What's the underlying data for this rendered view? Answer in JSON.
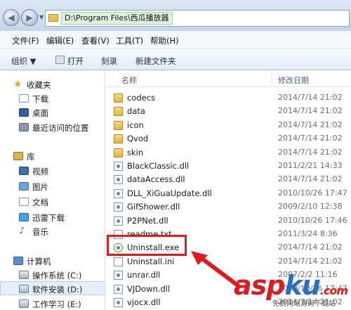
{
  "address_bar": {
    "path": "D:\\Program Files\\西瓜播放器"
  },
  "menu": [
    "文件(F)",
    "编辑(E)",
    "查看(V)",
    "工具(T)",
    "帮助(H)"
  ],
  "toolbar": {
    "organize": "组织 ▼",
    "open": "打开",
    "burn": "刻录",
    "new_folder": "新建文件夹"
  },
  "nav_pane": {
    "favorites_label": "收藏夹",
    "favorites": [
      "下载",
      "桌面",
      "最近访问的位置"
    ],
    "libraries_label": "库",
    "libraries": [
      "视频",
      "图片",
      "文档",
      "迅雷下载",
      "音乐"
    ],
    "computer_label": "计算机",
    "drives": [
      "操作系统 (C:)",
      "软件安装 (D:)",
      "工作学习 (E:)"
    ]
  },
  "file_list": {
    "col_name": "名称",
    "col_date": "修改日期",
    "files": [
      {
        "name": "codecs",
        "date": "2014/7/14 21:02",
        "type": "folder"
      },
      {
        "name": "data",
        "date": "2014/7/14 21:02",
        "type": "folder"
      },
      {
        "name": "icon",
        "date": "2014/7/14 21:02",
        "type": "folder"
      },
      {
        "name": "Qvod",
        "date": "2014/7/14 21:02",
        "type": "folder"
      },
      {
        "name": "skin",
        "date": "2014/7/14 21:02",
        "type": "folder"
      },
      {
        "name": "BlackClassic.dll",
        "date": "2011/2/21 14:33",
        "type": "dll"
      },
      {
        "name": "dataAccess.dll",
        "date": "2014/7/14 21:02",
        "type": "dll"
      },
      {
        "name": "DLL_XiGuaUpdate.dll",
        "date": "2010/10/26 17:47",
        "type": "dll"
      },
      {
        "name": "GifShower.dll",
        "date": "2009/2/10 12:38",
        "type": "dll"
      },
      {
        "name": "P2PNet.dll",
        "date": "2010/10/26 17:46",
        "type": "dll"
      },
      {
        "name": "readme.txt",
        "date": "2011/3/24 8:36",
        "type": "txt"
      },
      {
        "name": "Uninstall.exe",
        "date": "2014/7/14 21:02",
        "type": "exe"
      },
      {
        "name": "Uninstall.ini",
        "date": "2014/7/14 21:02",
        "type": "ini"
      },
      {
        "name": "unrar.dll",
        "date": "2007/2/2 11:16",
        "type": "dll"
      },
      {
        "name": "VJDown.dll",
        "date": "2010/10/26 17:47",
        "type": "dll"
      },
      {
        "name": "vjocx.dll",
        "date": "2014/7/14 21:02",
        "type": "dll"
      }
    ]
  },
  "watermark": {
    "brand_a": "asp",
    "brand_b": "ku",
    "brand_c": ".com",
    "sub": "免费网站源码下载站"
  }
}
